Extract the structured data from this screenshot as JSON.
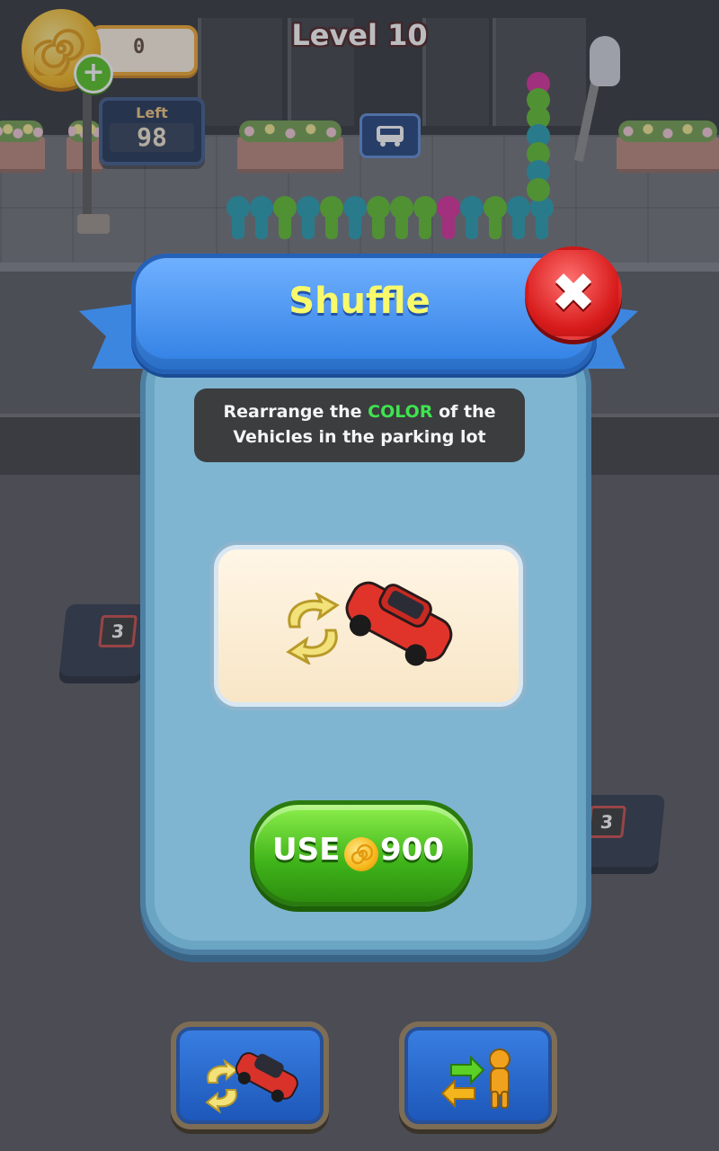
{
  "hud": {
    "level_title": "Level 10",
    "coin_count": "0",
    "add_coins_symbol": "+",
    "cars_left_label": "Left",
    "cars_left_value": "98"
  },
  "parking": {
    "slot_left_number": "3",
    "slot_right_number": "3"
  },
  "dialog": {
    "title": "Shuffle",
    "close_symbol": "✖",
    "description_before": "Rearrange the ",
    "description_highlight": "COLOR",
    "description_after": " of the Vehicles in the parking lot",
    "use_label": "USE",
    "use_price": "900"
  },
  "boosters": [
    {
      "icon": "shuffle-car-icon"
    },
    {
      "icon": "swap-person-icon"
    }
  ],
  "colors": {
    "highlight_green": "#3fe34f",
    "title_yellow": "#f8f96b",
    "close_red": "#d81b1b",
    "use_green": "#3fb31a",
    "car_red": "#e0342a"
  }
}
